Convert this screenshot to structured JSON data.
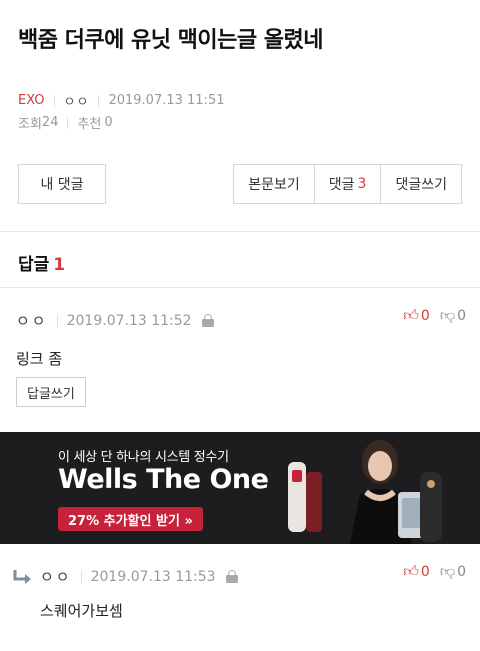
{
  "post": {
    "title": "백줌 더쿠에 유닛 맥이는글 올렸네",
    "board": "EXO",
    "author": "ㅇㅇ",
    "datetime": "2019.07.13 11:51",
    "views_label": "조회",
    "views": "24",
    "recommend_label": "추천",
    "recommend": "0"
  },
  "buttons": {
    "my_comments": "내 댓글",
    "view_post": "본문보기",
    "comments_label": "댓글",
    "comments_count": "3",
    "write_comment": "댓글쓰기"
  },
  "replies_header": {
    "label": "답글",
    "count": "1"
  },
  "comments": [
    {
      "author": "ㅇㅇ",
      "datetime": "2019.07.13 11:52",
      "up": "0",
      "down": "0",
      "text": "링크 좀",
      "reply_button": "답글쓰기"
    },
    {
      "author": "ㅇㅇ",
      "datetime": "2019.07.13 11:53",
      "up": "0",
      "down": "0",
      "text": "스퀘어가보셈"
    }
  ],
  "ad": {
    "subtitle": "이 세상 단 하나의 시스템 정수기",
    "title": "Wells The One",
    "cta": "27% 추가할인 받기 »"
  },
  "colors": {
    "accent": "#d63a3a",
    "ad_bg": "#1d1d1f",
    "ad_cta": "#c8213a"
  }
}
